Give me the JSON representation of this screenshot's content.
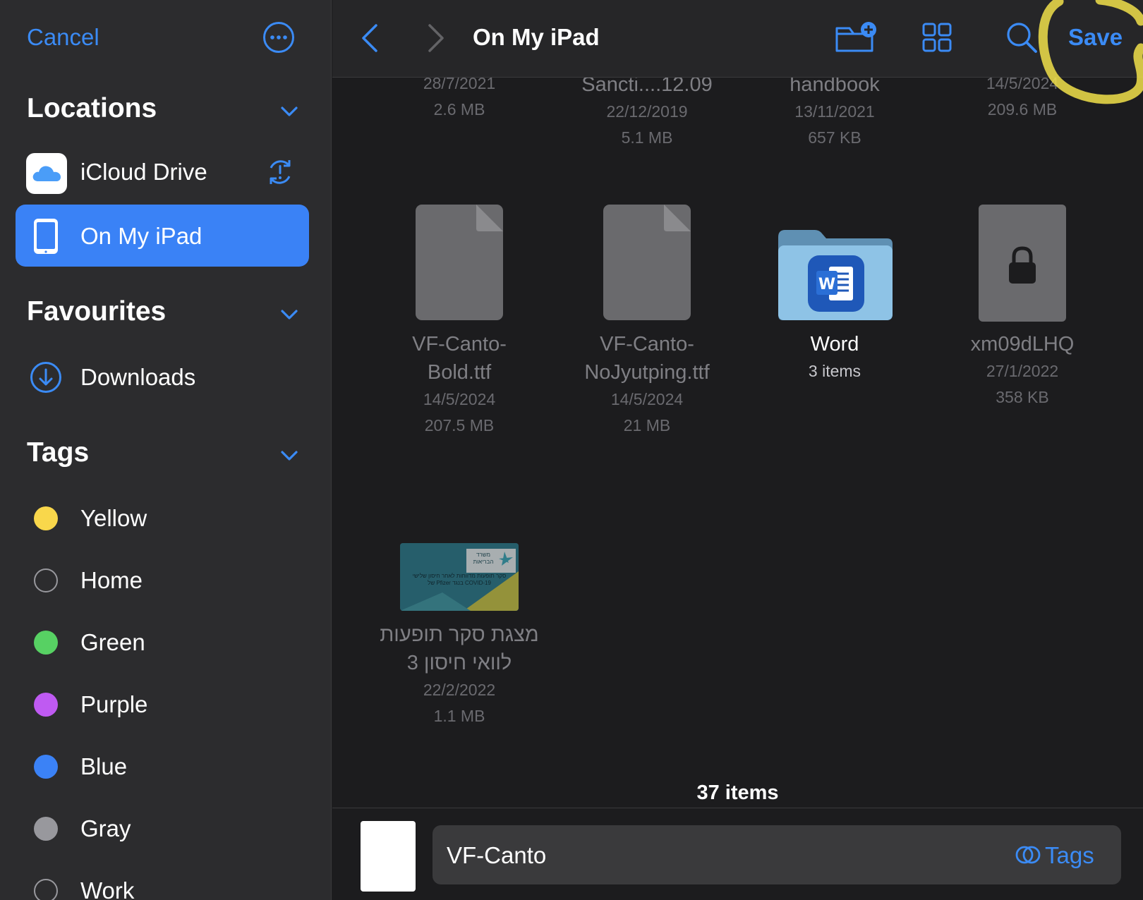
{
  "sidebar": {
    "cancel_label": "Cancel",
    "sections": {
      "locations": {
        "title": "Locations",
        "items": [
          {
            "label": "iCloud Drive",
            "icon": "icloud-icon",
            "badge_icon": "sync-alert-icon"
          },
          {
            "label": "On My iPad",
            "icon": "ipad-icon",
            "selected": true
          }
        ]
      },
      "favourites": {
        "title": "Favourites",
        "items": [
          {
            "label": "Downloads",
            "icon": "download-circle-icon"
          }
        ]
      },
      "tags": {
        "title": "Tags",
        "items": [
          {
            "label": "Yellow",
            "color": "#f9d74b"
          },
          {
            "label": "Home",
            "color": "none"
          },
          {
            "label": "Green",
            "color": "#57d163"
          },
          {
            "label": "Purple",
            "color": "#bf5af2"
          },
          {
            "label": "Blue",
            "color": "#3b82f6"
          },
          {
            "label": "Gray",
            "color": "#98989d"
          },
          {
            "label": "Work",
            "color": "none"
          }
        ]
      }
    }
  },
  "toolbar": {
    "title": "On My iPad",
    "save_label": "Save"
  },
  "files_top_row": [
    {
      "name": "",
      "date": "28/7/2021",
      "size": "2.6 MB"
    },
    {
      "name": "Sancti....12.09",
      "date": "22/12/2019",
      "size": "5.1 MB"
    },
    {
      "name": "handbook",
      "date": "13/11/2021",
      "size": "657 KB"
    },
    {
      "name": "",
      "date": "14/5/2024",
      "size": "209.6 MB"
    }
  ],
  "files": [
    {
      "name_line1": "VF-Canto-",
      "name_line2": "Bold.ttf",
      "date": "14/5/2024",
      "size": "207.5 MB",
      "kind": "document"
    },
    {
      "name_line1": "VF-Canto-",
      "name_line2": "NoJyutping.ttf",
      "date": "14/5/2024",
      "size": "21 MB",
      "kind": "document"
    },
    {
      "name_line1": "Word",
      "meta": "3 items",
      "kind": "folder"
    },
    {
      "name_line1": "xm09dLHQ",
      "date": "27/1/2022",
      "size": "358 KB",
      "kind": "locked"
    },
    {
      "name_line1": "מצגת סקר תופעות",
      "name_line2": "לוואי חיסון 3",
      "date": "22/2/2022",
      "size": "1.1 MB",
      "kind": "presentation",
      "thumb_text_line1": "סקר תופעות מדווחות לאחר חיסון שלישי",
      "thumb_text_line2": "COVID-19 בנגד Pfizer של",
      "thumb_brand_line1": "משרד",
      "thumb_brand_line2": "הבריאות"
    }
  ],
  "status": {
    "count_label": "37 items"
  },
  "save_bar": {
    "filename_value": "VF-Canto",
    "tags_label": "Tags"
  }
}
